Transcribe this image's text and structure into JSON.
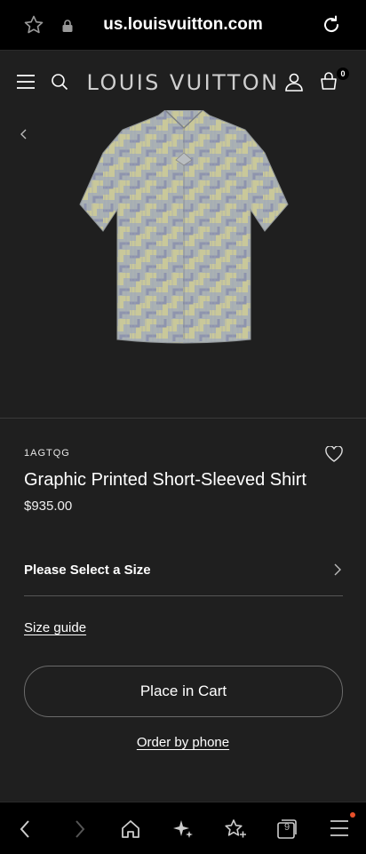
{
  "browser": {
    "url": "us.louisvuitton.com",
    "tabs_count": "9"
  },
  "header": {
    "brand": "LOUIS VUITTON",
    "cart_count": "0"
  },
  "product": {
    "sku": "1AGTQG",
    "title": "Graphic Printed Short-Sleeved Shirt",
    "price": "$935.00",
    "size_prompt": "Please Select a Size",
    "size_guide": "Size guide",
    "add_to_cart": "Place in Cart",
    "order_by_phone": "Order by phone"
  },
  "colors": {
    "background": "#1f1f1f",
    "bar": "#000000",
    "notification": "#e8502a"
  },
  "icons": [
    "star-icon",
    "lock-icon",
    "reload-icon",
    "menu-icon",
    "search-icon",
    "account-icon",
    "cart-icon",
    "chevron-left-icon",
    "heart-icon",
    "chevron-right-icon",
    "back-icon",
    "forward-icon",
    "home-icon",
    "sparkle-icon",
    "favorites-icon",
    "tabs-icon",
    "menu-more-icon"
  ]
}
